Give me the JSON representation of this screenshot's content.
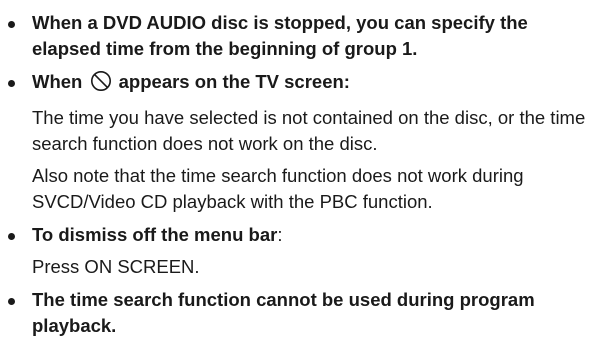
{
  "items": [
    {
      "lines": [
        "When a DVD AUDIO disc is stopped, you can specify the elapsed time from the beginning of group 1."
      ]
    },
    {
      "head_prefix": "When",
      "head_suffix": "appears on the TV screen:",
      "icon": "prohibited-icon",
      "paragraphs": [
        "The time you have selected is not contained on the disc, or the time search function does not work on the disc.",
        "Also note that the time search function does not work during SVCD/Video CD playback with the PBC function."
      ]
    },
    {
      "head": "To dismiss off the menu bar",
      "colon": ":",
      "paragraph": "Press ON SCREEN."
    },
    {
      "head": "The time search function cannot be used during program playback."
    }
  ]
}
